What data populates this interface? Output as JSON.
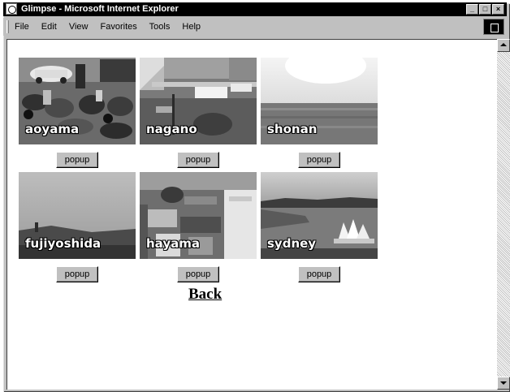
{
  "window": {
    "title": "Glimpse - Microsoft Internet Explorer",
    "controls": {
      "minimize": "_",
      "maximize": "□",
      "close": "×"
    }
  },
  "menubar": {
    "items": [
      "File",
      "Edit",
      "View",
      "Favorites",
      "Tools",
      "Help"
    ]
  },
  "webcams": [
    {
      "label": "aoyama",
      "button": "popup"
    },
    {
      "label": "nagano",
      "button": "popup"
    },
    {
      "label": "shonan",
      "button": "popup"
    },
    {
      "label": "fujiyoshida",
      "button": "popup"
    },
    {
      "label": "hayama",
      "button": "popup"
    },
    {
      "label": "sydney",
      "button": "popup"
    }
  ],
  "back_link": "Back"
}
